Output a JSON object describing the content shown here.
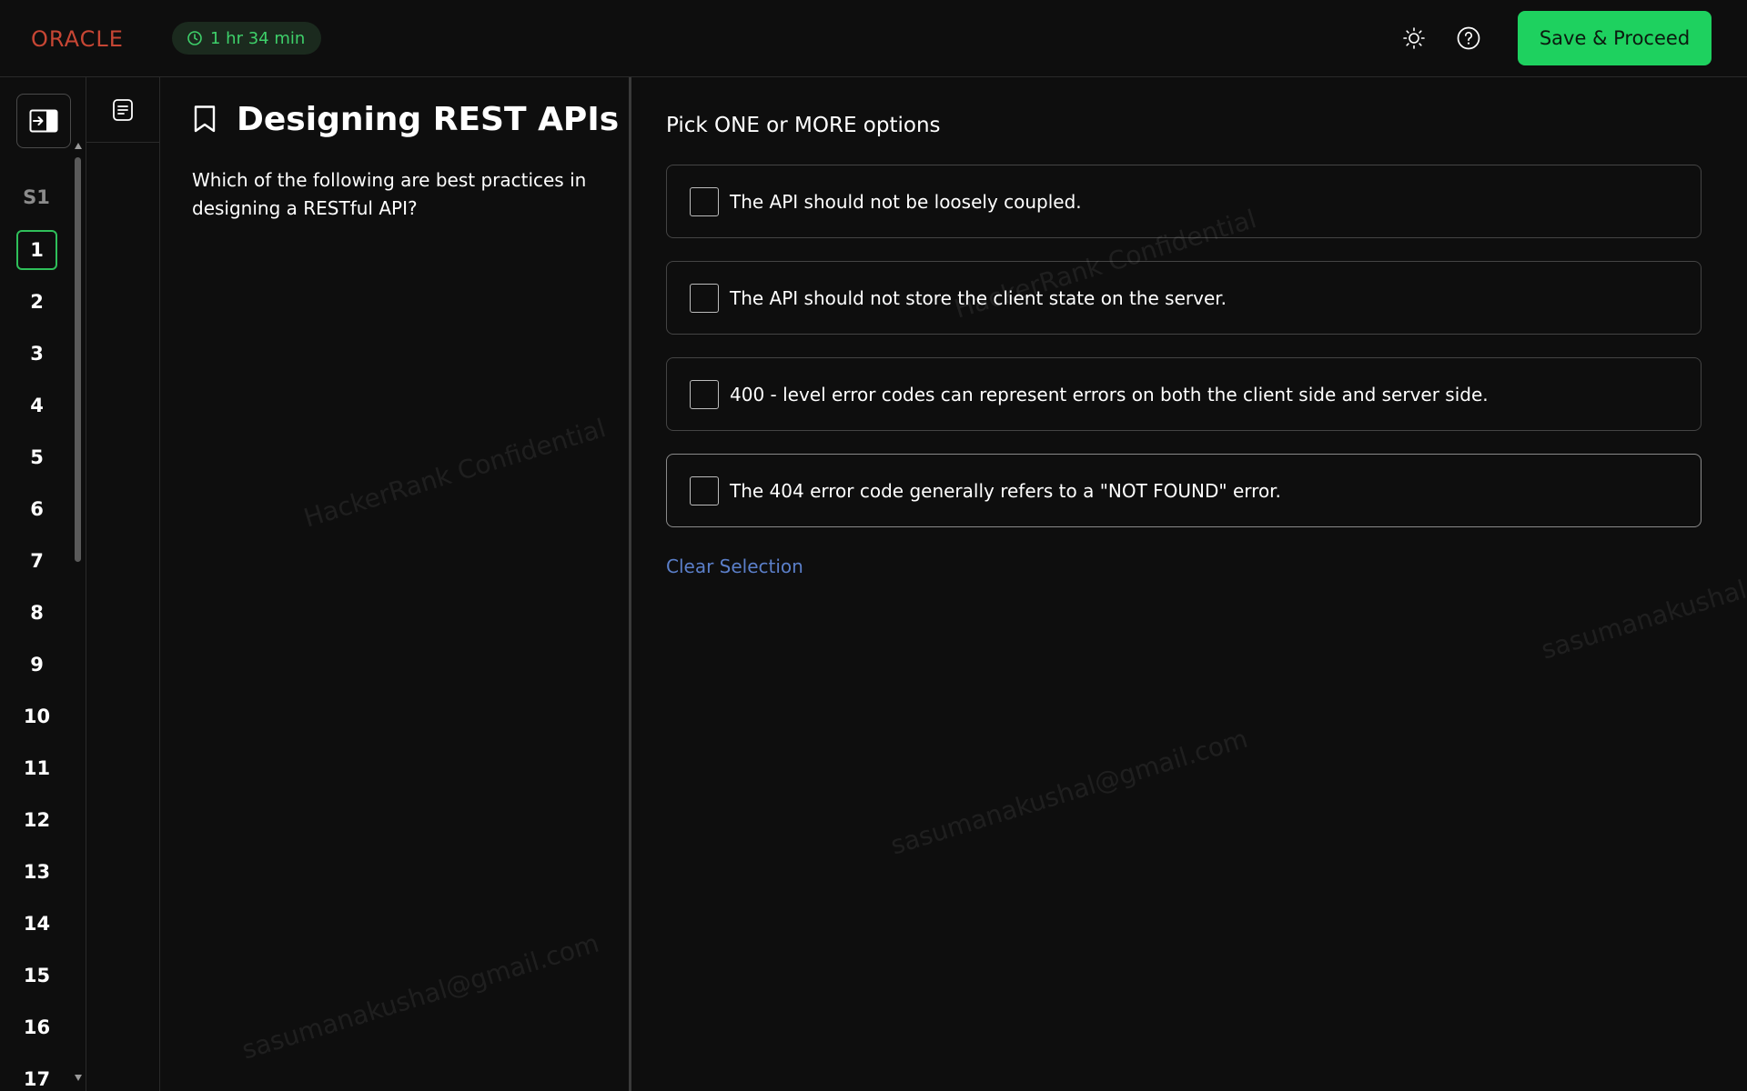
{
  "header": {
    "logo_text": "ORACLE",
    "timer": "1 hr 34 min",
    "save_label": "Save & Proceed"
  },
  "icons": {
    "logo": "oracle-logo",
    "timer": "clock-icon",
    "theme": "sun-icon",
    "help": "question-circle-icon",
    "collapse": "panel-expand-icon",
    "questions_tab": "document-list-icon",
    "bookmark": "bookmark-icon"
  },
  "colors": {
    "accent": "#1ed15f",
    "timer_text": "#3ed06a",
    "brand_red": "#c74634",
    "link": "#5b7fc9",
    "background": "#0e0e0e"
  },
  "sidebar": {
    "section": "S1",
    "active_question": "1",
    "questions": [
      "1",
      "2",
      "3",
      "4",
      "5",
      "6",
      "7",
      "8",
      "9",
      "10",
      "11",
      "12",
      "13",
      "14",
      "15",
      "16",
      "17"
    ]
  },
  "question": {
    "title": "Designing REST APIs",
    "text": "Which of the following are best practices in designing a RESTful API?"
  },
  "answers": {
    "instruction": "Pick ONE or MORE options",
    "options": [
      "The API should not be loosely coupled.",
      "The API should not store the client state on the server.",
      "400 - level error codes can represent errors on both the client side and server side.",
      "The 404 error code generally refers to a \"NOT FOUND\" error."
    ],
    "clear_label": "Clear Selection"
  },
  "watermarks": {
    "confidential": "HackerRank Confidential",
    "email": "sasumanakushal@gmail.com"
  }
}
